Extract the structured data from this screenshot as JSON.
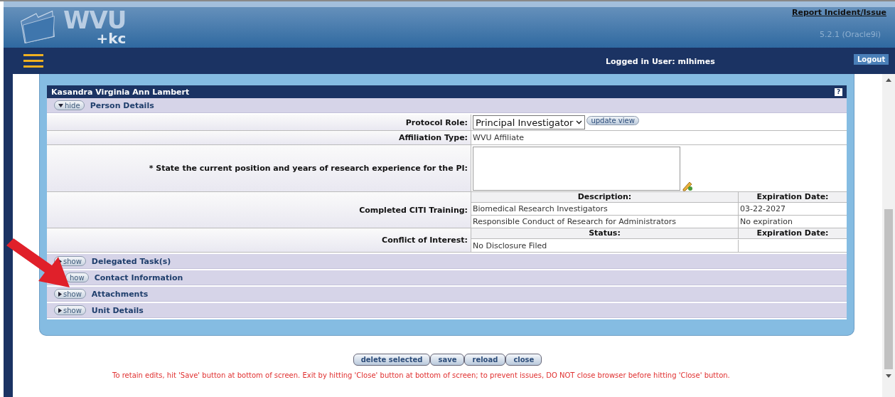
{
  "header": {
    "logo_text": "WVU",
    "logo_subtext": "+kc",
    "report_link": "Report Incident/Issue",
    "version": "5.2.1 (Oracle9i)"
  },
  "nav": {
    "logged_in": "Logged in User: mlhimes",
    "logout": "Logout"
  },
  "panel": {
    "title": "Kasandra Virginia Ann Lambert",
    "help": "?",
    "sections": [
      {
        "toggle": "hide",
        "title": "Person Details",
        "expanded": true
      },
      {
        "toggle": "show",
        "title": "Delegated Task(s)",
        "expanded": false
      },
      {
        "toggle": "how",
        "title": "Contact Information",
        "expanded": false,
        "covered": true
      },
      {
        "toggle": "show",
        "title": "Attachments",
        "expanded": false
      },
      {
        "toggle": "show",
        "title": "Unit Details",
        "expanded": false
      }
    ],
    "person_details": {
      "protocol_role": {
        "label": "Protocol Role:",
        "value": "Principal Investigator",
        "button": "update view"
      },
      "affiliation": {
        "label": "Affiliation Type:",
        "value": "WVU Affiliate"
      },
      "question": {
        "label": "* State the current position and years of research experience for the PI:"
      },
      "citi": {
        "label": "Completed CITI Training:",
        "columns": [
          "Description:",
          "Expiration Date:"
        ],
        "rows": [
          [
            "Biomedical Research Investigators",
            "03-22-2027"
          ],
          [
            "Responsible Conduct of Research for Administrators",
            "No expiration"
          ]
        ]
      },
      "coi": {
        "label": "Conflict of Interest:",
        "columns": [
          "Status:",
          "Expiration Date:"
        ],
        "rows": [
          [
            "No Disclosure Filed",
            ""
          ]
        ]
      }
    }
  },
  "buttons": [
    "delete selected",
    "save",
    "reload",
    "close"
  ],
  "notice": "To retain edits, hit 'Save' button at bottom of screen. Exit by hitting 'Close' button at bottom of screen; to prevent issues, DO NOT close browser before hitting 'Close' button."
}
